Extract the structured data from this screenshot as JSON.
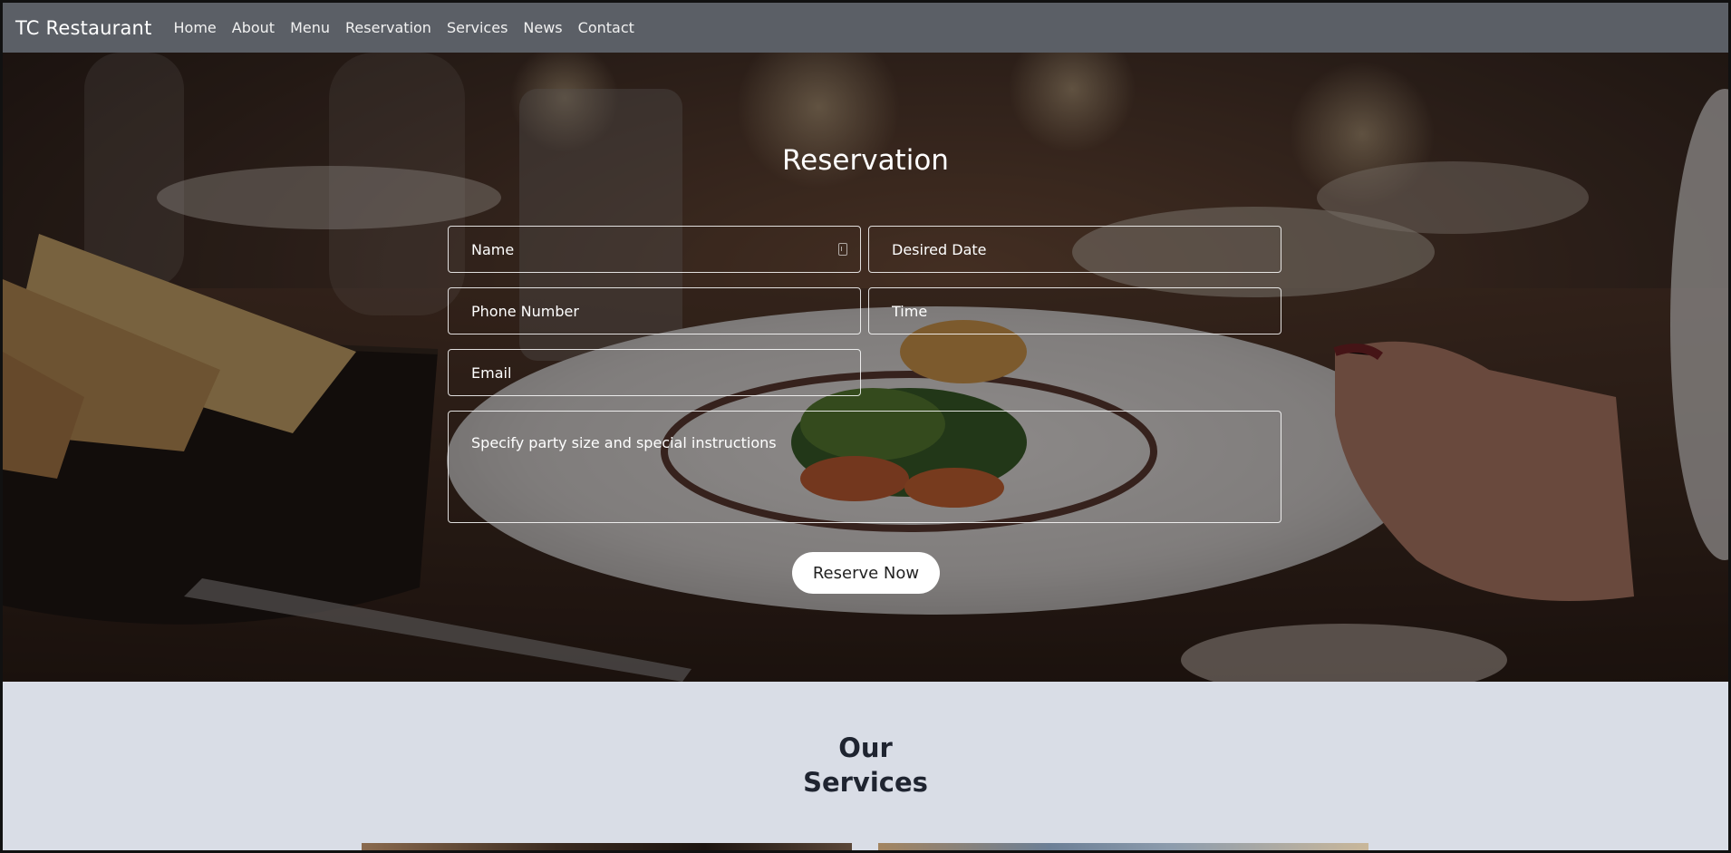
{
  "navbar": {
    "brand": "TC Restaurant",
    "links": [
      "Home",
      "About",
      "Menu",
      "Reservation",
      "Services",
      "News",
      "Contact"
    ]
  },
  "reservation": {
    "title": "Reservation",
    "fields": {
      "name": "Name",
      "date": "Desired Date",
      "phone": "Phone Number",
      "time": "Time",
      "email": "Email",
      "instructions": "Specify party size and special instructions"
    },
    "submit_label": "Reserve Now"
  },
  "services": {
    "title_line1": "Our",
    "title_line2": "Services"
  },
  "colors": {
    "navbar_bg": "#5b5f66",
    "services_bg": "#d9dde6",
    "button_bg": "#ffffff"
  }
}
